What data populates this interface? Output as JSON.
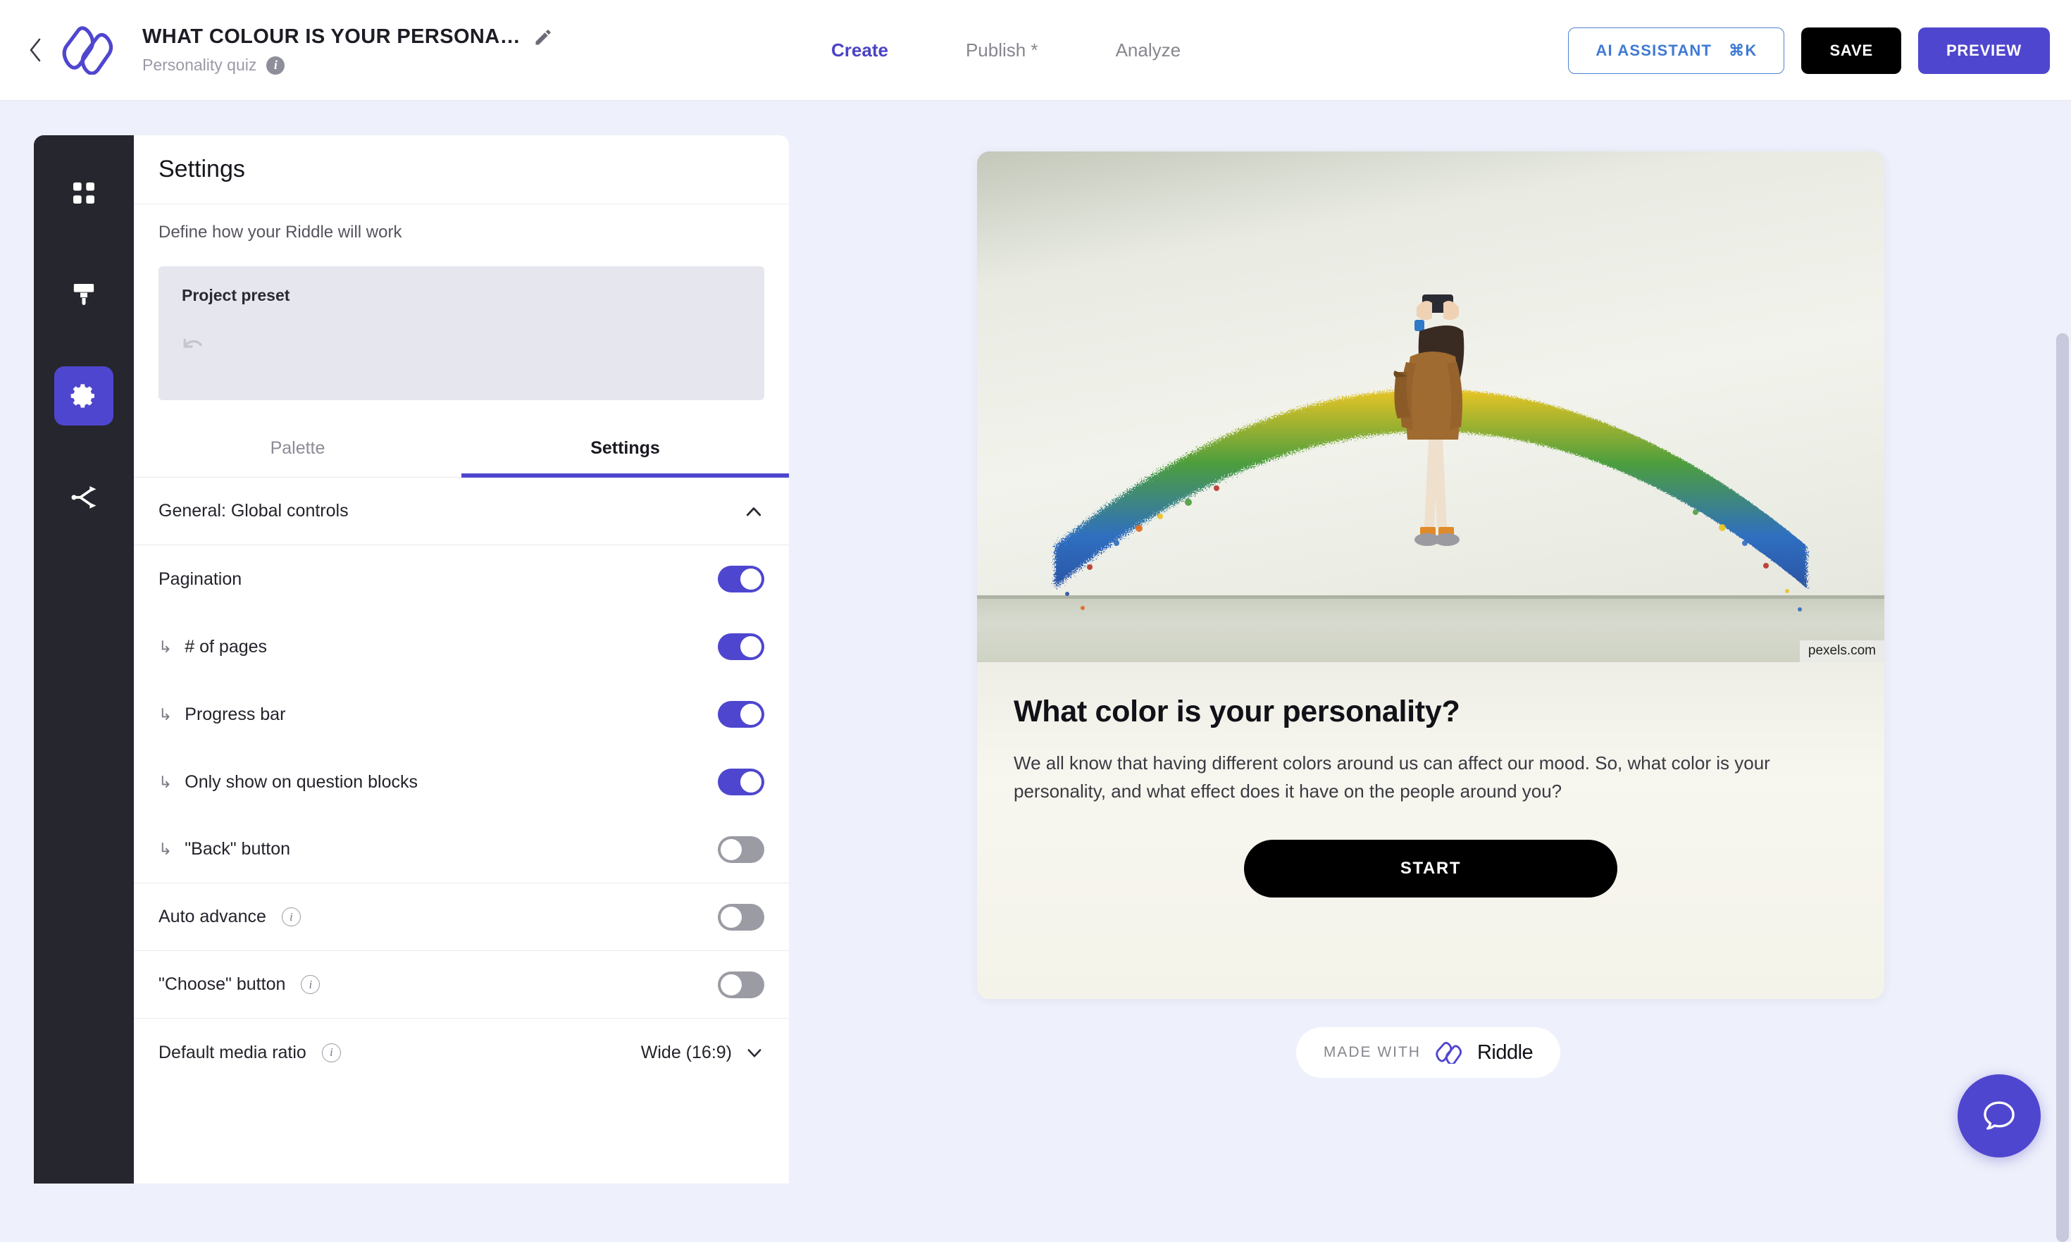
{
  "header": {
    "back_icon": "chevron-left-icon",
    "logo": "riddle-logo",
    "project_title": "WHAT COLOUR IS YOUR PERSONA…",
    "edit_icon": "pencil-icon",
    "project_type": "Personality quiz",
    "info_icon": "info-icon",
    "nav": [
      {
        "label": "Create",
        "active": true
      },
      {
        "label": "Publish *",
        "active": false
      },
      {
        "label": "Analyze",
        "active": false
      }
    ],
    "actions": {
      "ai_assistant": "AI ASSISTANT",
      "ai_assistant_shortcut": "⌘K",
      "save": "SAVE",
      "preview": "PREVIEW"
    }
  },
  "rail": {
    "items": [
      {
        "name": "blocks-grid-icon",
        "active": false
      },
      {
        "name": "paintbrush-icon",
        "active": false
      },
      {
        "name": "gear-icon",
        "active": true
      },
      {
        "name": "share-nodes-icon",
        "active": false
      }
    ]
  },
  "panel": {
    "title": "Settings",
    "subtitle": "Define how your Riddle will work",
    "preset": {
      "label": "Project preset",
      "reset_icon": "undo-arrow-icon"
    },
    "tabs": [
      {
        "label": "Palette",
        "active": false
      },
      {
        "label": "Settings",
        "active": true
      }
    ],
    "section": {
      "label": "General: Global controls",
      "collapse_icon": "chevron-up-icon",
      "expanded": true
    },
    "rows": [
      {
        "label": "Pagination",
        "sub": false,
        "info": false,
        "control": "toggle",
        "value": "on"
      },
      {
        "label": "# of pages",
        "sub": true,
        "info": false,
        "control": "toggle",
        "value": "on"
      },
      {
        "label": "Progress bar",
        "sub": true,
        "info": false,
        "control": "toggle",
        "value": "on"
      },
      {
        "label": "Only show on question blocks",
        "sub": true,
        "info": false,
        "control": "toggle",
        "value": "on"
      },
      {
        "label": "\"Back\" button",
        "sub": true,
        "info": false,
        "control": "toggle",
        "value": "off"
      },
      {
        "label": "Auto advance",
        "sub": false,
        "info": true,
        "control": "toggle",
        "value": "off"
      },
      {
        "label": "\"Choose\" button",
        "sub": false,
        "info": true,
        "control": "toggle",
        "value": "off"
      },
      {
        "label": "Default media ratio",
        "sub": false,
        "info": true,
        "control": "select",
        "value": "Wide (16:9)"
      }
    ],
    "sub_arrow_glyph": "↳"
  },
  "preview": {
    "image_credit": "pexels.com",
    "image_alt": "rainbow-wall-art-photo",
    "title": "What color is your personality?",
    "description": "We all know that having different colors around us can affect our mood. So, what color is your personality, and what effect does it have on the people around you?",
    "start_button": "START",
    "badge": {
      "prefix": "MADE WITH",
      "brand": "Riddle"
    }
  },
  "chat": {
    "icon": "chat-bubble-icon"
  },
  "colors": {
    "accent": "#4f46cf",
    "accent_text": "#4a43c4",
    "rail_bg": "#26262e",
    "page_bg": "#eef0fb",
    "toggle_on": "#4f46cf",
    "toggle_off": "#9b9ba4",
    "ai_border": "#4b83d6",
    "ai_text": "#3f7ad4",
    "save_bg": "#000000"
  }
}
